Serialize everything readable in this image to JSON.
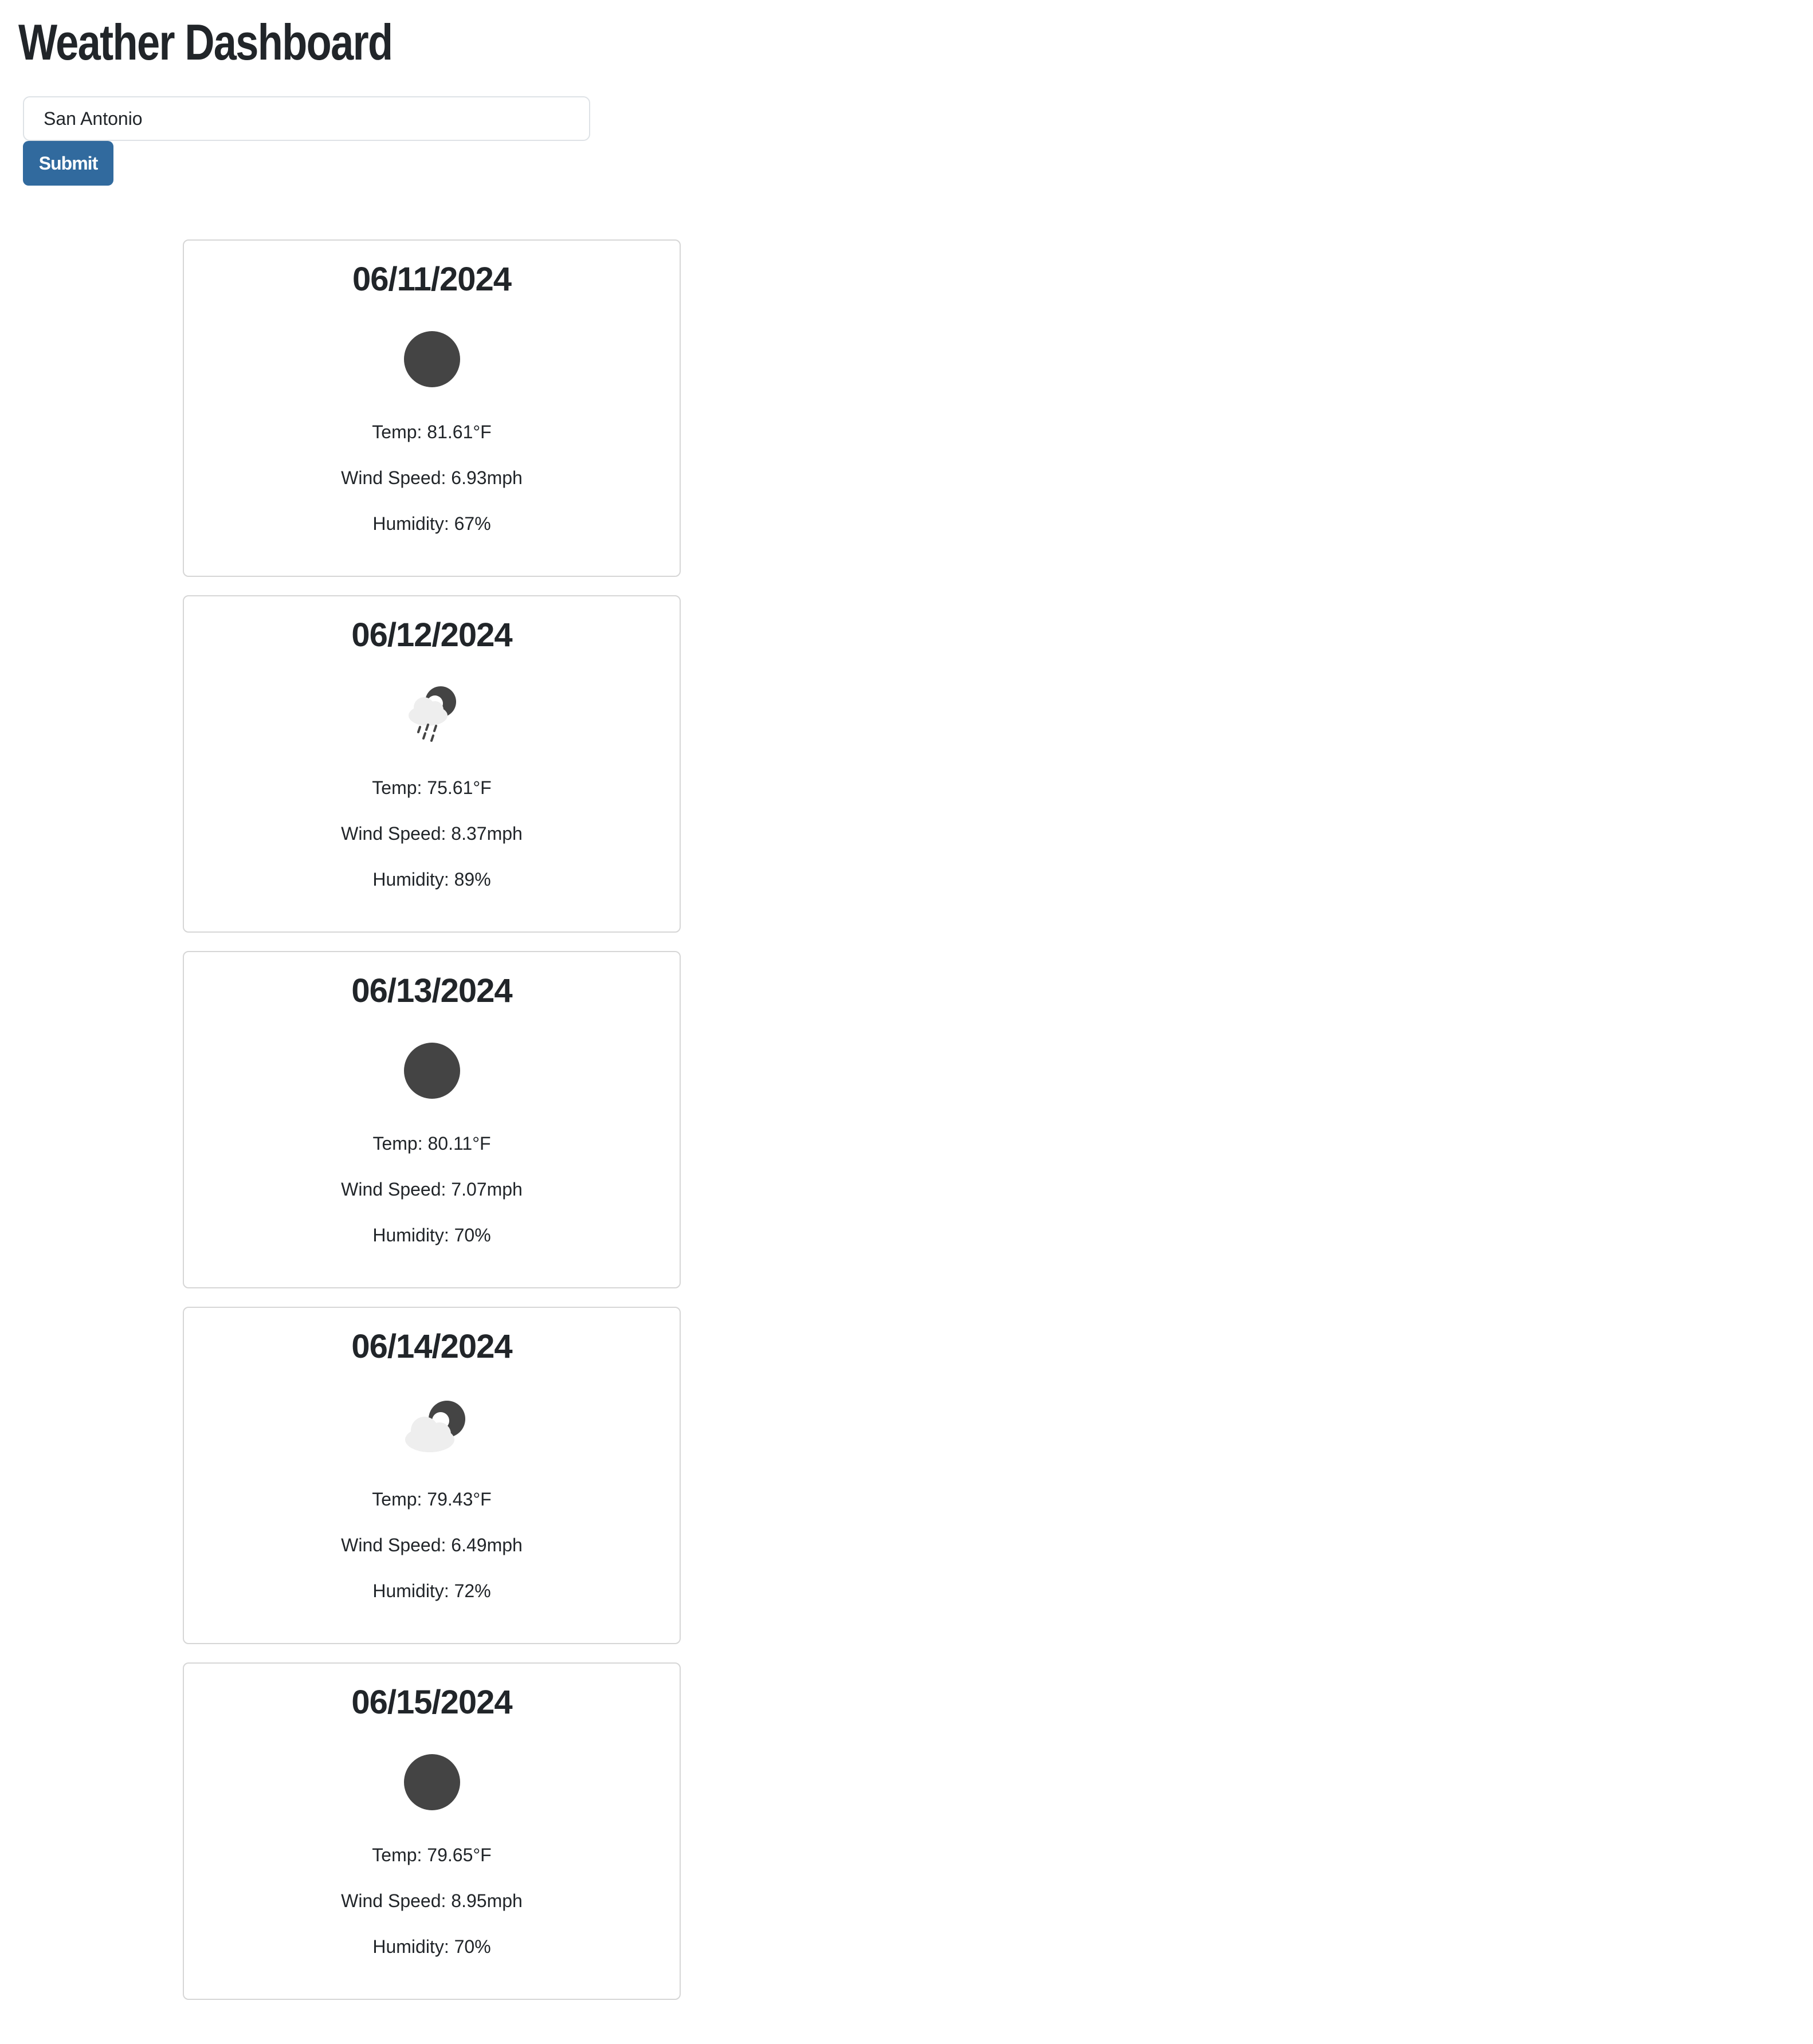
{
  "header": {
    "title": "Weather Dashboard"
  },
  "search": {
    "value": "San Antonio",
    "submit_label": "Submit"
  },
  "forecast": [
    {
      "date": "06/11/2024",
      "icon": "moon-icon",
      "temp": "Temp: 81.61°F",
      "wind": "Wind Speed: 6.93mph",
      "humidity": "Humidity: 67%"
    },
    {
      "date": "06/12/2024",
      "icon": "moon-rain-cloud-icon",
      "temp": "Temp: 75.61°F",
      "wind": "Wind Speed: 8.37mph",
      "humidity": "Humidity: 89%"
    },
    {
      "date": "06/13/2024",
      "icon": "moon-icon",
      "temp": "Temp: 80.11°F",
      "wind": "Wind Speed: 7.07mph",
      "humidity": "Humidity: 70%"
    },
    {
      "date": "06/14/2024",
      "icon": "moon-cloud-icon",
      "temp": "Temp: 79.43°F",
      "wind": "Wind Speed: 6.49mph",
      "humidity": "Humidity: 72%"
    },
    {
      "date": "06/15/2024",
      "icon": "moon-icon",
      "temp": "Temp: 79.65°F",
      "wind": "Wind Speed: 8.95mph",
      "humidity": "Humidity: 70%"
    }
  ],
  "colors": {
    "button": "#316a9e",
    "moon": "#444444",
    "cloud": "#eeeeee",
    "card_border": "#d6d6d6"
  }
}
